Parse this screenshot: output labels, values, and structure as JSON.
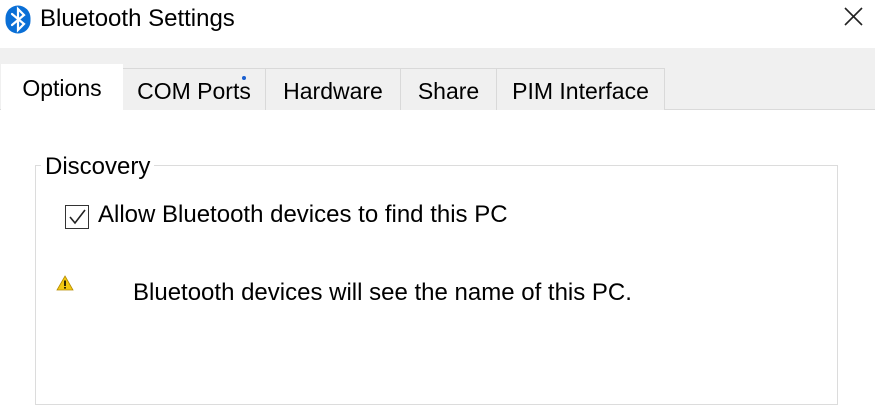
{
  "window": {
    "title": "Bluetooth Settings",
    "icon": "bluetooth-icon",
    "close_icon": "close-icon"
  },
  "tabs": [
    {
      "label": "Options",
      "selected": true
    },
    {
      "label": "COM Ports",
      "selected": false
    },
    {
      "label": "Hardware",
      "selected": false
    },
    {
      "label": "Share",
      "selected": false
    },
    {
      "label": "PIM Interface",
      "selected": false
    }
  ],
  "discovery": {
    "group_label": "Discovery",
    "allow_checkbox": {
      "label": "Allow Bluetooth devices to find this PC",
      "checked": true
    },
    "warning": {
      "icon": "warning-icon",
      "text": "Bluetooth devices will see the name of this PC."
    }
  },
  "colors": {
    "bluetooth_blue": "#0a6fd6",
    "tab_strip_bg": "#f0f0f0",
    "warning_yellow": "#f2c811",
    "focus_dot": "#1a5fd0"
  }
}
